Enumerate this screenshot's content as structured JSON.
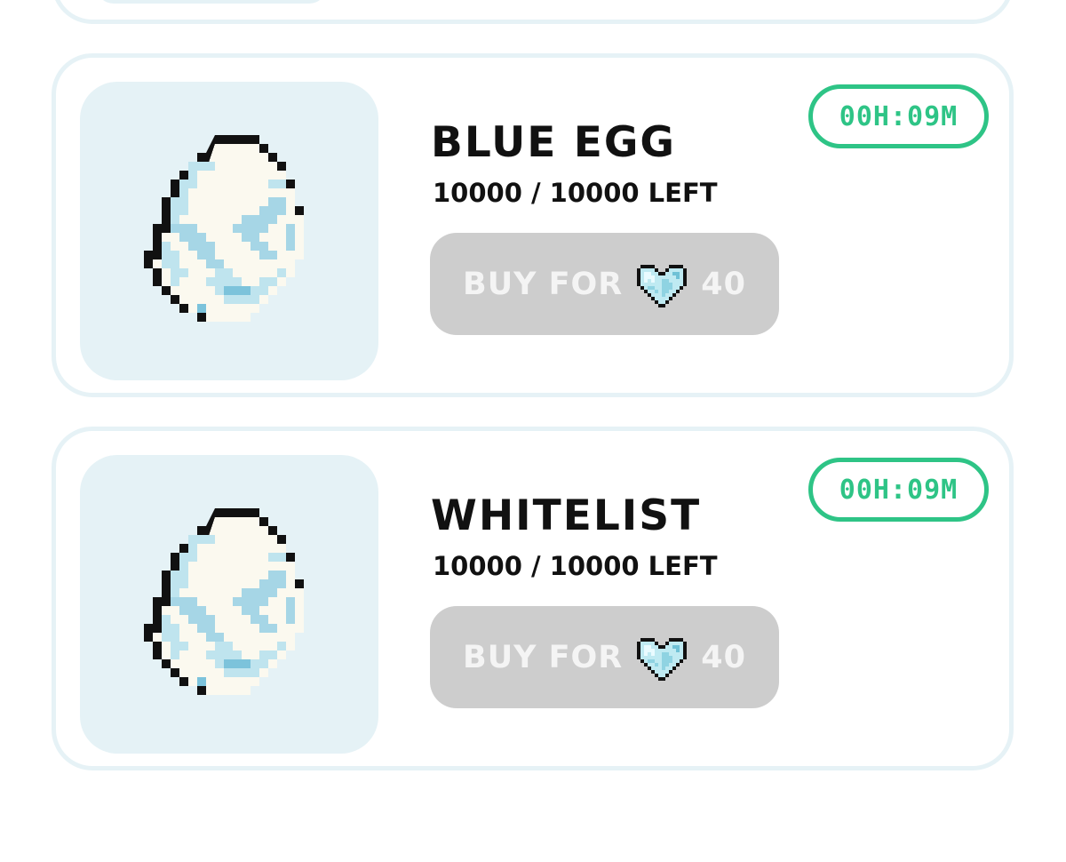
{
  "colors": {
    "card_border": "#e6f2f6",
    "thumb_bg": "#e5f2f6",
    "button_bg": "#cdcdcd",
    "button_text": "#f4f4f4",
    "timer_accent": "#2ec486",
    "text": "#111111"
  },
  "items": [
    {
      "title": "BLUE EGG",
      "stock": "10000 / 10000 LEFT",
      "buy_label": "BUY FOR",
      "price": "40",
      "timer": "00H:09M",
      "image_icon": "blue-egg-icon",
      "currency_icon": "diamond-heart-icon"
    },
    {
      "title": "WHITELIST",
      "stock": "10000 / 10000 LEFT",
      "buy_label": "BUY FOR",
      "price": "40",
      "timer": "00H:09M",
      "image_icon": "blue-egg-icon",
      "currency_icon": "diamond-heart-icon"
    }
  ]
}
